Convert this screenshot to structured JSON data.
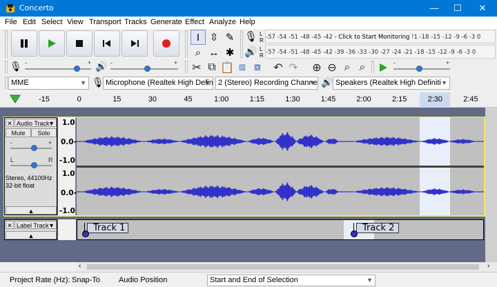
{
  "window": {
    "title": "Concerto",
    "minimize_glyph": "—",
    "maximize_glyph": "☐",
    "close_glyph": "✕"
  },
  "menu": [
    "File",
    "Edit",
    "Select",
    "View",
    "Transport",
    "Tracks",
    "Generate",
    "Effect",
    "Analyze",
    "Help"
  ],
  "transport": {
    "icons": [
      "pause-icon",
      "play-icon",
      "stop-icon",
      "skip-to-start-icon",
      "skip-to-end-icon",
      "record-icon"
    ]
  },
  "tools": {
    "row1": [
      "selection-tool-icon",
      "envelope-tool-icon",
      "draw-tool-icon"
    ],
    "row2": [
      "zoom-tool-icon",
      "timeshift-tool-icon",
      "multi-tool-icon"
    ],
    "selected": "selection-tool-icon"
  },
  "meters": {
    "record_scale": "-57 -54 -51 -48 -45 -42 -",
    "record_prompt": "Click to Start Monitoring",
    "record_scale_right": "!1 -18 -15 -12  -9  -6  -3  0",
    "playback_scale": "-57 -54 -51 -48 -45 -42 -39 -36 -33 -30 -27 -24 -21 -18 -15 -12  -9  -6  -3  0",
    "channel_left": "L",
    "channel_right": "R"
  },
  "mixer": {
    "minus": "-",
    "plus": "+",
    "record_volume": 0.82,
    "playback_volume": 0.55
  },
  "play_at_speed": {
    "speed": 0.45,
    "minus": "-",
    "plus": "+"
  },
  "device": {
    "host": "MME",
    "recording_device": "Microphone (Realtek High Defini",
    "channels": "2 (Stereo) Recording Channels",
    "playback_device": "Speakers (Realtek High Definiti"
  },
  "timeline": {
    "ticks": [
      "-15",
      "0",
      "15",
      "30",
      "45",
      "1:00",
      "1:15",
      "1:30",
      "1:45",
      "2:00",
      "2:15",
      "2:30",
      "2:45"
    ]
  },
  "audio_track": {
    "name": "Audio Track",
    "mute": "Mute",
    "solo": "Solo",
    "gain_minus": "-",
    "gain_plus": "+",
    "pan_left": "L",
    "pan_right": "R",
    "info_line1": "Stereo, 44100Hz",
    "info_line2": "32-bit float",
    "scale_top": "1.0",
    "scale_mid": "0.0-",
    "scale_bottom": "-1.0",
    "wave_color": "#3232c8",
    "selection_color": "#e9effa"
  },
  "label_track": {
    "name": "Label Track",
    "labels": [
      "Track 1",
      "Track 2"
    ]
  },
  "status": {
    "project_rate_label": "Project Rate (Hz):",
    "snap_label": "Snap-To",
    "audio_position_label": "Audio Position",
    "selection_mode": "Start and End of Selection"
  }
}
